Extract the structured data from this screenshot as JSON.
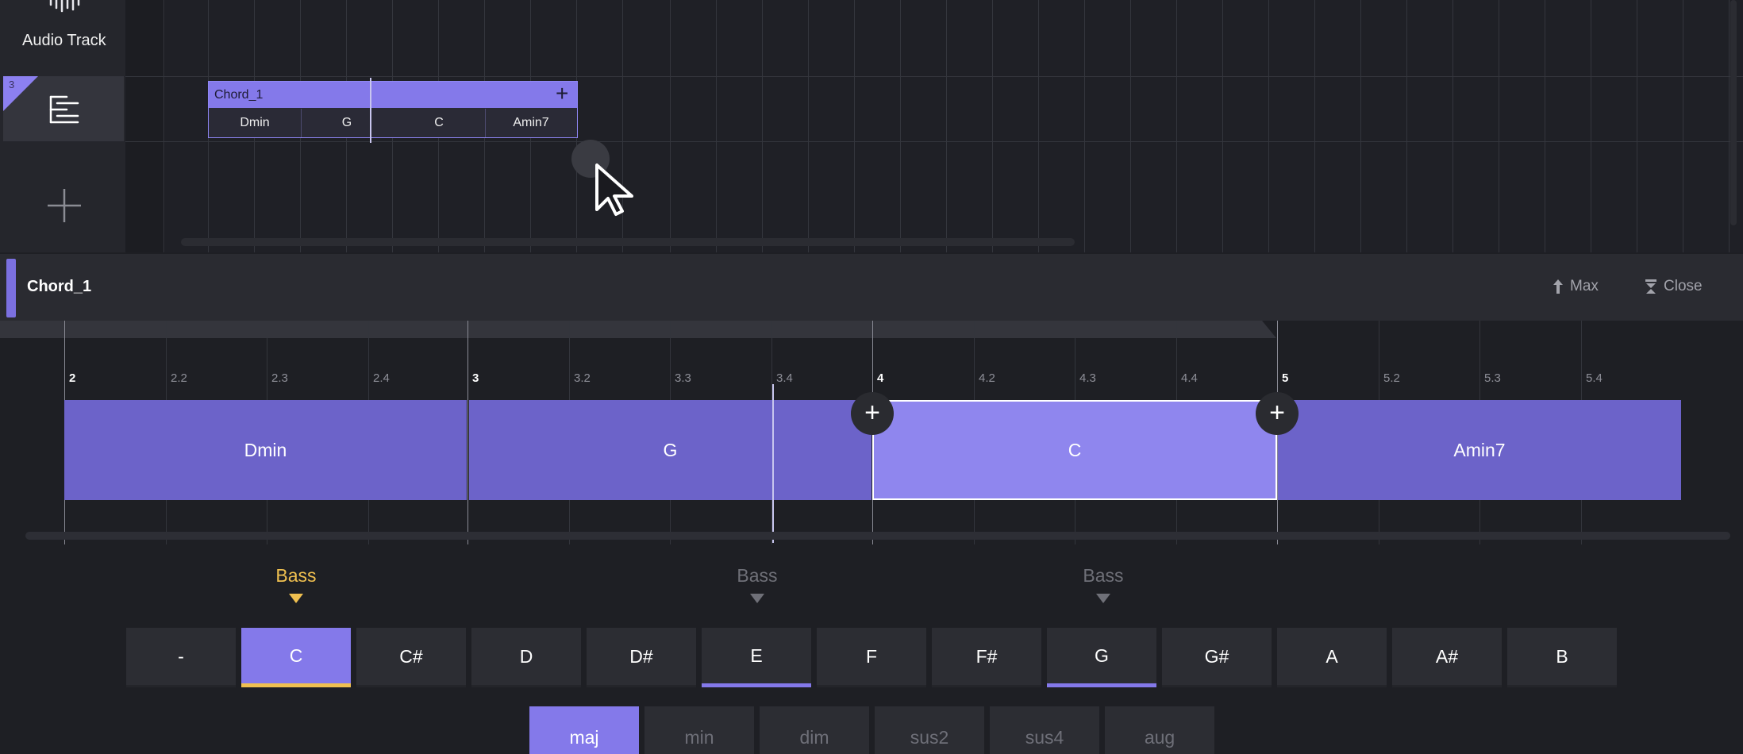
{
  "arrangement": {
    "audio_track_label": "Audio Track",
    "track_number": "3",
    "clip": {
      "name": "Chord_1",
      "add_symbol": "+",
      "chords": [
        "Dmin",
        "G",
        "C",
        "Amin7"
      ]
    },
    "add_track_symbol": "+"
  },
  "editor": {
    "title": "Chord_1",
    "max_label": "Max",
    "close_label": "Close",
    "ruler_ticks": [
      "2",
      "2.2",
      "2.3",
      "2.4",
      "3",
      "3.2",
      "3.3",
      "3.4",
      "4",
      "4.2",
      "4.3",
      "4.4",
      "5",
      "5.2",
      "5.3",
      "5.4"
    ],
    "chords": [
      "Dmin",
      "G",
      "C",
      "Amin7"
    ],
    "selected_chord": "C",
    "insert_symbol": "+"
  },
  "bass_labels": [
    "Bass",
    "Bass",
    "Bass"
  ],
  "notes": [
    "-",
    "C",
    "C#",
    "D",
    "D#",
    "E",
    "F",
    "F#",
    "G",
    "G#",
    "A",
    "A#",
    "B"
  ],
  "selected_note": "C",
  "chord_tones": [
    "C",
    "E",
    "G"
  ],
  "qualities": [
    "maj",
    "min",
    "dim",
    "sus2",
    "sus4",
    "aug"
  ],
  "selected_quality": "maj",
  "colors": {
    "accent": "#8479ea",
    "bass_highlight": "#f0c050",
    "chord_block": "#6c63c9"
  }
}
